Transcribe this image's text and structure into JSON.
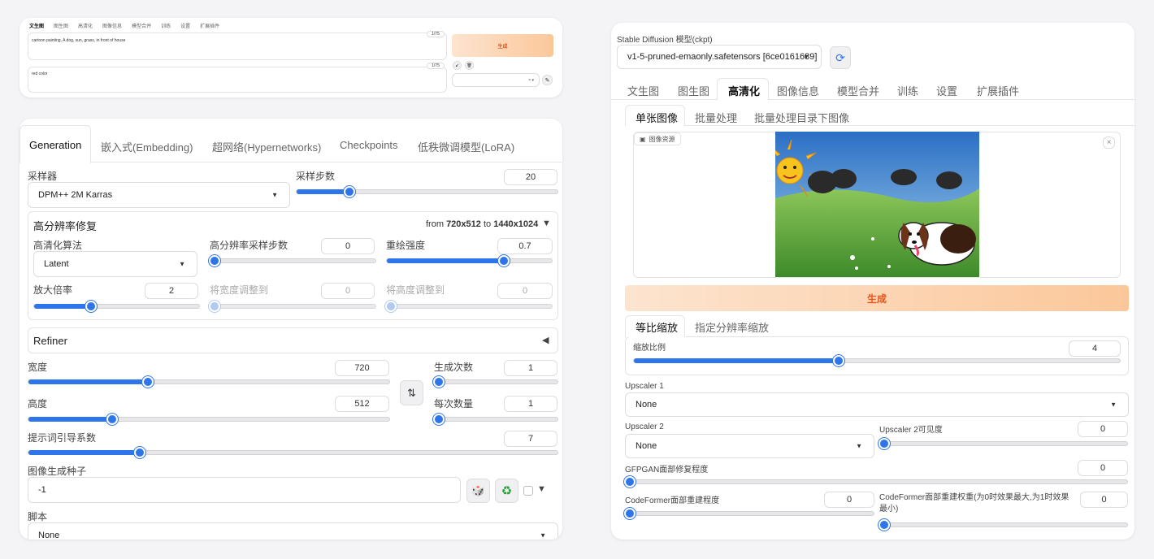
{
  "top_card": {
    "tabs": [
      "文生图",
      "图生图",
      "高清化",
      "图像信息",
      "模型合并",
      "训练",
      "设置",
      "扩展插件"
    ],
    "prompt": "cartoon painting, A dog, sun, grass, in front of house",
    "prompt_count": "1/75",
    "negative": "red color",
    "negative_count": "1/75",
    "generate": "生成",
    "tool_icon_1": "↙",
    "tool_icon_2": "🗑",
    "style_clear": "× ▾",
    "edit_icon": "✎"
  },
  "left": {
    "tabs": [
      "Generation",
      "嵌入式(Embedding)",
      "超网络(Hypernetworks)",
      "Checkpoints",
      "低秩微调模型(LoRA)"
    ],
    "sampler_label": "采样器",
    "sampler_value": "DPM++ 2M Karras",
    "steps_label": "采样步数",
    "steps_value": "20",
    "steps_frac": 0.2,
    "hires": {
      "title": "高分辨率修复",
      "from_label": "from",
      "from_res": "720x512",
      "to_label": "to",
      "to_res": "1440x1024",
      "toggle": "▼",
      "upscaler_label": "高清化算法",
      "upscaler_value": "Latent",
      "hires_steps_label": "高分辨率采样步数",
      "hires_steps_value": "0",
      "denoise_label": "重绘强度",
      "denoise_value": "0.7",
      "denoise_frac": 0.7,
      "scale_label": "放大倍率",
      "scale_value": "2",
      "scale_frac": 0.34,
      "width_label": "将宽度调整到",
      "width_value": "0",
      "height_label": "将高度调整到",
      "height_value": "0"
    },
    "refiner": "Refiner",
    "refiner_toggle": "◀",
    "width_label": "宽度",
    "width_value": "720",
    "width_frac": 0.33,
    "height_label": "高度",
    "height_value": "512",
    "height_frac": 0.23,
    "batch_count_label": "生成次数",
    "batch_count_value": "1",
    "batch_size_label": "每次数量",
    "batch_size_value": "1",
    "swap_icon": "⇅",
    "cfg_label": "提示词引导系数",
    "cfg_value": "7",
    "cfg_frac": 0.21,
    "seed_label": "图像生成种子",
    "seed_value": "-1",
    "dice_icon": "🎲",
    "recycle_icon": "♻",
    "seed_toggle": "▼",
    "script_label": "脚本",
    "script_value": "None"
  },
  "right": {
    "model_label": "Stable Diffusion 模型(ckpt)",
    "model_value": "v1-5-pruned-emaonly.safetensors [6ce0161689]",
    "refresh_icon": "⟳",
    "tabs": [
      "文生图",
      "图生图",
      "高清化",
      "图像信息",
      "模型合并",
      "训练",
      "设置",
      "扩展插件"
    ],
    "subtabs": [
      "单张图像",
      "批量处理",
      "批量处理目录下图像"
    ],
    "image_source": "图像资源",
    "close_icon": "×",
    "generate": "生成",
    "resize_tabs": [
      "等比缩放",
      "指定分辨率缩放"
    ],
    "scale_label": "缩放比例",
    "scale_value": "4",
    "scale_frac": 0.42,
    "upscaler1_label": "Upscaler 1",
    "upscaler1_value": "None",
    "upscaler2_label": "Upscaler 2",
    "upscaler2_value": "None",
    "upscaler2_vis_label": "Upscaler 2可见度",
    "upscaler2_vis_value": "0",
    "gfpgan_label": "GFPGAN面部修复程度",
    "gfpgan_value": "0",
    "codeformer_label": "CodeFormer面部重建程度",
    "codeformer_value": "0",
    "codeformer_w_label": "CodeFormer面部重建权重(为0时效果最大,为1时效果最小)",
    "codeformer_w_value": "0"
  }
}
